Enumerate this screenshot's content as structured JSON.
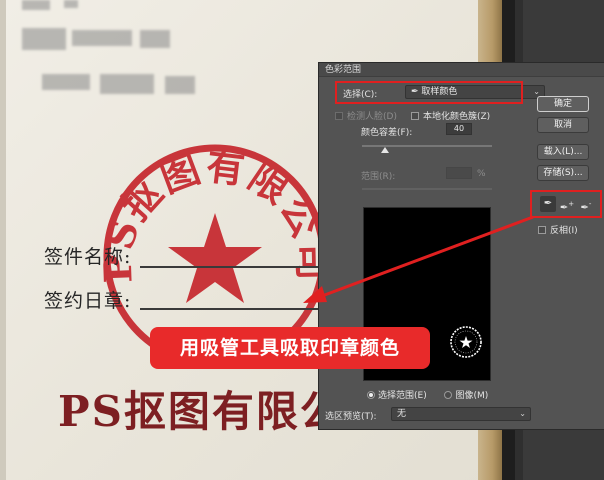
{
  "document": {
    "field_signer_label": "签件名称:",
    "field_date_label": "签约日章:",
    "company_print": "PS抠图有限公",
    "stamp_text": "PS抠图有限公司"
  },
  "dialog": {
    "title": "色彩范围",
    "select_label": "选择(C):",
    "select_value": "取样颜色",
    "detect_faces_label": "检测人脸(D)",
    "localized_clusters_label": "本地化颜色簇(Z)",
    "fuzziness_label": "颜色容差(F):",
    "fuzziness_value": "40",
    "range_label": "范围(R):",
    "range_unit": "%",
    "preview_option_selection": "选择范围(E)",
    "preview_option_image": "图像(M)",
    "selection_preview_label": "选区预览(T):",
    "selection_preview_value": "无",
    "buttons": {
      "ok": "确定",
      "cancel": "取消",
      "load": "载入(L)...",
      "save": "存储(S)..."
    },
    "eyedroppers": [
      "eyedropper-icon",
      "eyedropper-plus-icon",
      "eyedropper-minus-icon"
    ],
    "invert_label": "反相(I)"
  },
  "annotation": {
    "caption": "用吸管工具吸取印章颜色",
    "highlight_color": "#e02020"
  },
  "colors": {
    "stamp_red": "#c8353a",
    "print_red": "#7d1f22",
    "dialog_bg": "#535353"
  }
}
